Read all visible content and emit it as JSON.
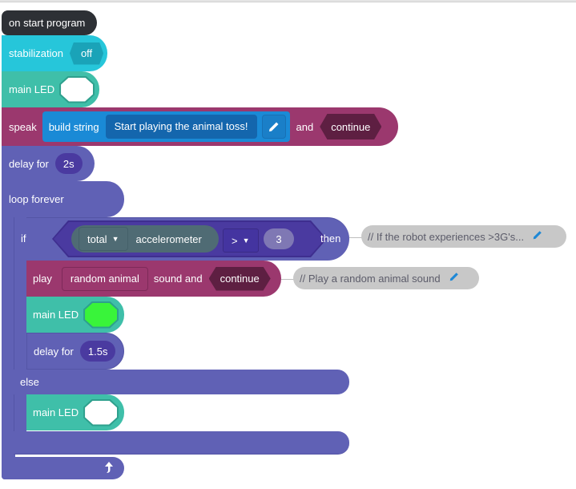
{
  "colors": {
    "event": "#2d3035",
    "stabilization": "#26c6da",
    "stabilization_field": "#1aa3b8",
    "led": "#3fbfa9",
    "sound": "#9b386e",
    "sound_dark": "#5e1f42",
    "string": "#1a8ad6",
    "string_field": "#1466ad",
    "control": "#6061b5",
    "control_dark": "#4a3aa0",
    "sensor": "#4f6b74",
    "comment_bg": "#c8c8c8",
    "led_green": "#39f43a",
    "led_white": "#ffffff"
  },
  "blocks": {
    "start": {
      "label": "on start program"
    },
    "stabilization": {
      "label": "stabilization",
      "value": "off"
    },
    "led1": {
      "label": "main LED",
      "color": "white"
    },
    "speak": {
      "label": "speak",
      "builder": "build string",
      "text": "Start playing the animal toss!",
      "edit_icon": "pencil-icon",
      "and": "and",
      "mode": "continue"
    },
    "delay1": {
      "label": "delay for",
      "value": "2s"
    },
    "loop": {
      "label": "loop forever",
      "return_icon": "loop-arrow-icon"
    },
    "if": {
      "label": "if",
      "then": "then",
      "sensor_mode": "total",
      "sensor": "accelerometer",
      "operator": ">",
      "threshold": "3",
      "comment": "// If the robot experiences >3G's...",
      "else": "else"
    },
    "play": {
      "label": "play",
      "sound": "random animal",
      "suffix": "sound and",
      "mode": "continue",
      "comment": "// Play a random animal sound"
    },
    "led2": {
      "label": "main LED",
      "color": "green"
    },
    "delay2": {
      "label": "delay for",
      "value": "1.5s"
    },
    "led3": {
      "label": "main LED",
      "color": "white"
    }
  }
}
